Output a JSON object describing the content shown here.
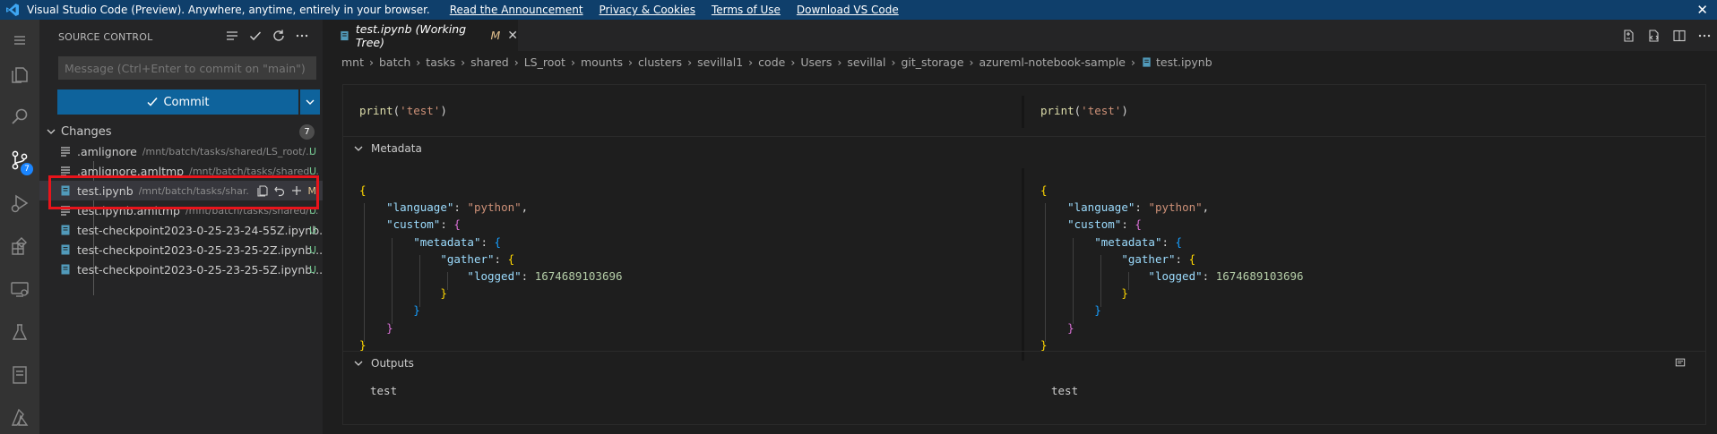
{
  "banner": {
    "title": "Visual Studio Code (Preview). Anywhere, anytime, entirely in your browser.",
    "links": [
      "Read the Announcement",
      "Privacy & Cookies",
      "Terms of Use",
      "Download VS Code"
    ],
    "close_glyph": "✕"
  },
  "activity_bar": {
    "icons": [
      "files-icon",
      "search-icon",
      "source-control-icon",
      "run-debug-icon",
      "extensions-icon",
      "remote-explorer-icon",
      "testing-icon",
      "notebook-icon",
      "azure-icon"
    ],
    "source_control_badge": "7"
  },
  "sidebar": {
    "title": "SOURCE CONTROL",
    "commit_placeholder": "Message (Ctrl+Enter to commit on \"main\")",
    "commit_label": "Commit",
    "changes_label": "Changes",
    "changes_count": "7",
    "files": [
      {
        "name": ".amlignore",
        "path": "/mnt/batch/tasks/shared/LS_root/...",
        "status": "U"
      },
      {
        "name": ".amlignore.amltmp",
        "path": "/mnt/batch/tasks/shared...",
        "status": "U"
      },
      {
        "name": "test.ipynb",
        "path": "/mnt/batch/tasks/shar...",
        "status": "M"
      },
      {
        "name": "test.ipynb.amltmp",
        "path": "/mnt/batch/tasks/shared/...",
        "status": "U"
      },
      {
        "name": "test-checkpoint2023-0-25-23-24-55Z.ipynb...",
        "path": "",
        "status": "U"
      },
      {
        "name": "test-checkpoint2023-0-25-23-25-2Z.ipynb...",
        "path": "",
        "status": "U"
      },
      {
        "name": "test-checkpoint2023-0-25-23-25-5Z.ipynb...",
        "path": "",
        "status": "U"
      }
    ]
  },
  "editor": {
    "tab": {
      "title": "test.ipynb (Working Tree)",
      "status": "M",
      "close_glyph": "✕"
    },
    "breadcrumbs": [
      "mnt",
      "batch",
      "tasks",
      "shared",
      "LS_root",
      "mounts",
      "clusters",
      "sevillal1",
      "code",
      "Users",
      "sevillal",
      "git_storage",
      "azureml-notebook-sample",
      "test.ipynb"
    ],
    "cell_source": {
      "fn": "print",
      "open": "(",
      "arg": "'test'",
      "close": ")"
    },
    "metadata_label": "Metadata",
    "outputs_label": "Outputs",
    "metadata": {
      "language_key": "\"language\"",
      "language_value": "\"python\"",
      "custom_key": "\"custom\"",
      "metadata_key": "\"metadata\"",
      "gather_key": "\"gather\"",
      "logged_key": "\"logged\"",
      "logged_value": "1674689103696"
    },
    "output_left": "test",
    "output_right": "test"
  },
  "colors": {
    "banner_bg": "#0f3f6b",
    "activity_bar_bg": "#333333",
    "sidebar_bg": "#252526",
    "editor_bg": "#1e1e1e",
    "commit_button_bg": "#0e639c",
    "highlight_box": "#e8141b",
    "untracked_status": "#73c991",
    "modified_status": "#e2c08d"
  }
}
